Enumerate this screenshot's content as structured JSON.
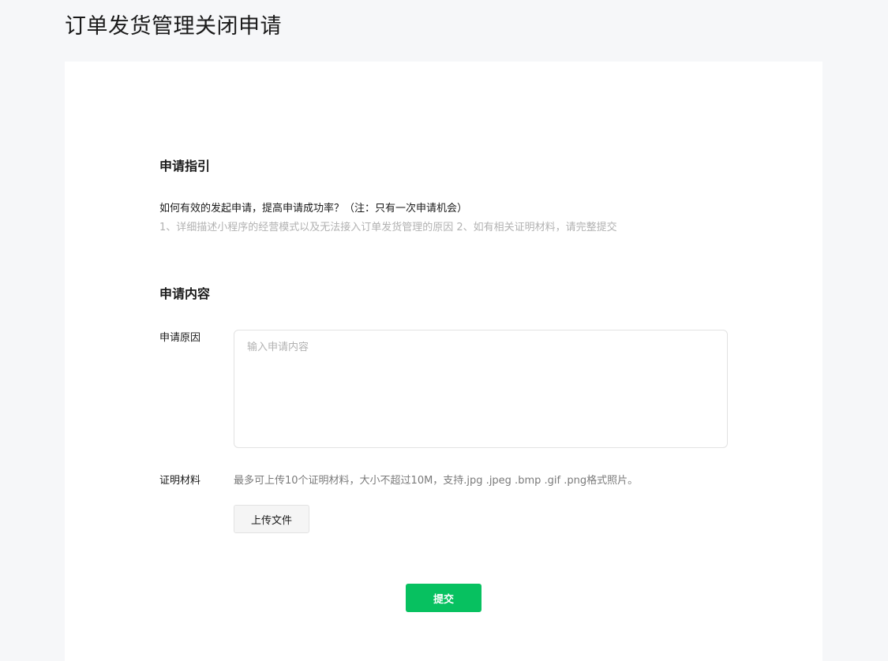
{
  "page": {
    "title": "订单发货管理关闭申请"
  },
  "guide": {
    "section_title": "申请指引",
    "question": "如何有效的发起申请，提高申请成功率？（注：只有一次申请机会）",
    "tips": "1、详细描述小程序的经营模式以及无法接入订单发货管理的原因 2、如有相关证明材料，请完整提交"
  },
  "content": {
    "section_title": "申请内容",
    "reason": {
      "label": "申请原因",
      "value": "",
      "placeholder": "输入申请内容"
    },
    "proof": {
      "label": "证明材料",
      "hint": "最多可上传10个证明材料，大小不超过10M，支持.jpg .jpeg .bmp .gif .png格式照片。",
      "upload_label": "上传文件"
    },
    "submit_label": "提交"
  },
  "colors": {
    "accent": "#07c160",
    "page_bg": "#f6f7f9",
    "card_bg": "#ffffff",
    "muted_text": "#b2b2b2"
  }
}
